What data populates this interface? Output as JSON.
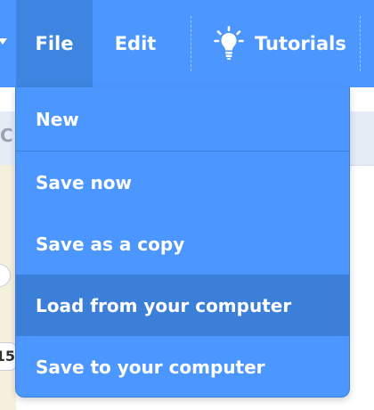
{
  "menubar": {
    "file_label": "File",
    "edit_label": "Edit",
    "tutorials_label": "Tutorials",
    "tutorials_icon": "lightbulb-icon"
  },
  "file_menu": {
    "items": [
      {
        "label": "New"
      },
      {
        "label": "Save now"
      },
      {
        "label": "Save as a copy"
      },
      {
        "label": "Load from your computer",
        "highlighted": true
      },
      {
        "label": "Save to your computer"
      }
    ]
  },
  "background": {
    "partial_letter": "C",
    "partial_input_value": "15"
  },
  "colors": {
    "menubar": "#4c97ff",
    "menu_active": "#3d85e0",
    "item_hover": "#3b7fd9",
    "text": "#ffffff"
  }
}
